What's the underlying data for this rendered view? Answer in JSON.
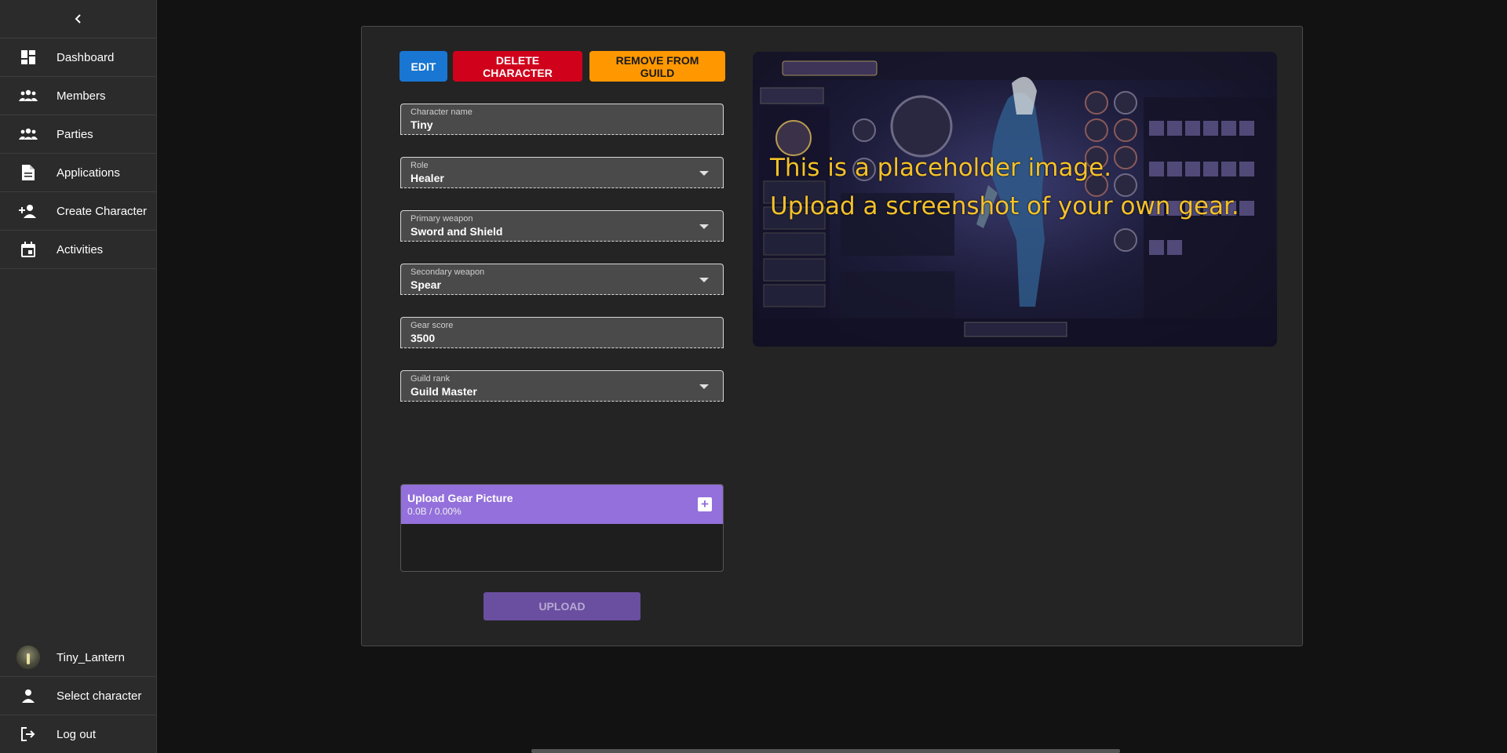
{
  "sidebar": {
    "collapse_icon": "chevron-left-icon",
    "items": [
      {
        "label": "Dashboard",
        "icon": "dashboard-icon"
      },
      {
        "label": "Members",
        "icon": "group-icon"
      },
      {
        "label": "Parties",
        "icon": "group-icon"
      },
      {
        "label": "Applications",
        "icon": "document-icon"
      },
      {
        "label": "Create Character",
        "icon": "person-add-icon"
      },
      {
        "label": "Activities",
        "icon": "calendar-icon"
      }
    ],
    "bottom": {
      "user": "Tiny_Lantern",
      "select_character": "Select character",
      "logout": "Log out"
    }
  },
  "actions": {
    "edit": "Edit",
    "delete": "Delete character",
    "remove": "Remove from guild"
  },
  "form": {
    "character_name": {
      "label": "Character name",
      "value": "Tiny"
    },
    "role": {
      "label": "Role",
      "value": "Healer"
    },
    "primary_weapon": {
      "label": "Primary weapon",
      "value": "Sword and Shield"
    },
    "secondary_weapon": {
      "label": "Secondary weapon",
      "value": "Spear"
    },
    "gear_score": {
      "label": "Gear score",
      "value": "3500"
    },
    "guild_rank": {
      "label": "Guild rank",
      "value": "Guild Master"
    }
  },
  "upload": {
    "title": "Upload Gear Picture",
    "size": "0.0B / 0.00%",
    "button": "UPLOAD"
  },
  "gear_image": {
    "line1": "This is  a placeholder image.",
    "line2": "Upload a screenshot of your own gear."
  },
  "colors": {
    "edit": "#1976d2",
    "delete": "#d0021b",
    "remove": "#ff9800",
    "upload_header": "#9370db",
    "overlay_text": "#f4c12a"
  }
}
